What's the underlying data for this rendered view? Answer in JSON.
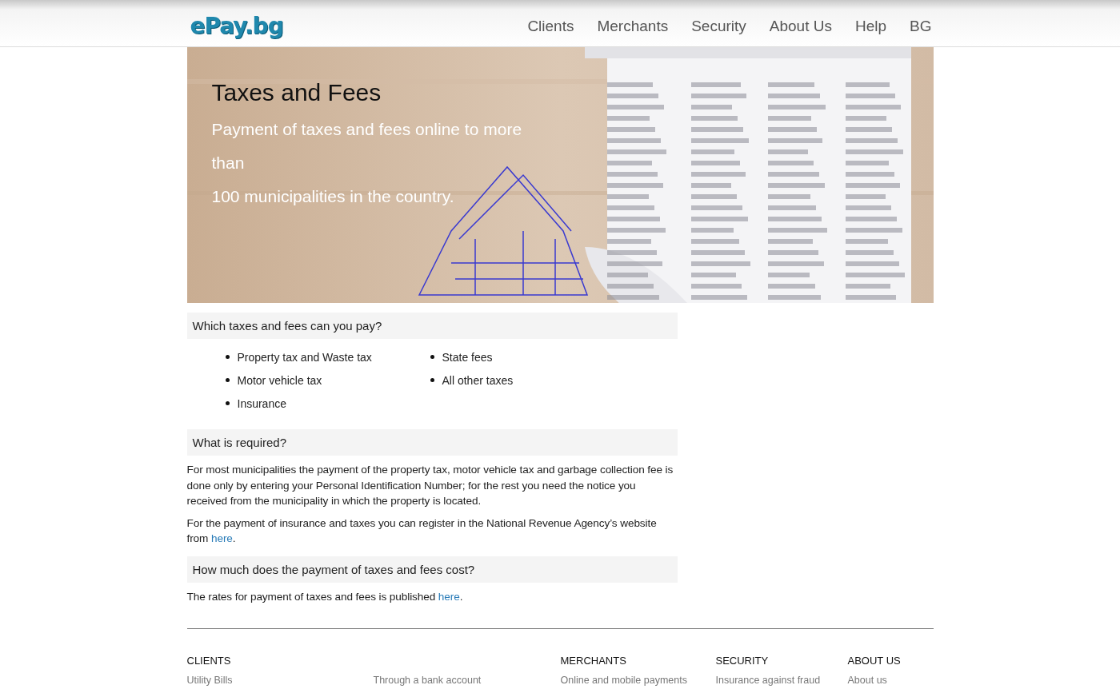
{
  "header": {
    "logo": "ePay.bg",
    "nav": [
      {
        "label": "Clients"
      },
      {
        "label": "Merchants"
      },
      {
        "label": "Security"
      },
      {
        "label": "About Us"
      },
      {
        "label": "Help"
      },
      {
        "label": "BG"
      }
    ]
  },
  "banner": {
    "kind": "picture",
    "title": "Taxes and Fees",
    "subtitle_lines": [
      "Payment of taxes and fees online to more",
      "than",
      "100 municipalities in the country."
    ]
  },
  "sections": [
    {
      "heading": "Which taxes and fees can you pay?",
      "columns": [
        [
          "Property tax and Waste tax",
          "Motor vehicle tax",
          "Insurance"
        ],
        [
          "State fees",
          "All other taxes"
        ]
      ]
    },
    {
      "heading": "What is required?",
      "paragraphs": [
        {
          "text": "For most municipalities the payment of the property tax, motor vehicle tax and garbage collection fee is done only by entering your Personal Identification Number; for the rest you need the notice you received from the municipality in which the property is located."
        },
        {
          "text": "For the payment of insurance and taxes you can register in the National Revenue Agency’s website from ",
          "link": "here",
          "after": "."
        }
      ]
    },
    {
      "heading": "How much does the payment of taxes and fees cost?",
      "paragraphs": [
        {
          "text": "The rates for payment of taxes and fees is published ",
          "link": "here",
          "after": "."
        }
      ]
    }
  ],
  "footer": {
    "columns": [
      {
        "heading": "CLIENTS",
        "links": [
          "Utility Bills"
        ]
      },
      {
        "links": [
          "Through a bank account"
        ]
      },
      {
        "heading": "MERCHANTS",
        "links": [
          "Online and mobile payments"
        ]
      },
      {
        "heading": "SECURITY",
        "links": [
          "Insurance against fraud"
        ]
      },
      {
        "heading": "ABOUT US",
        "links": [
          "About us"
        ]
      }
    ]
  }
}
